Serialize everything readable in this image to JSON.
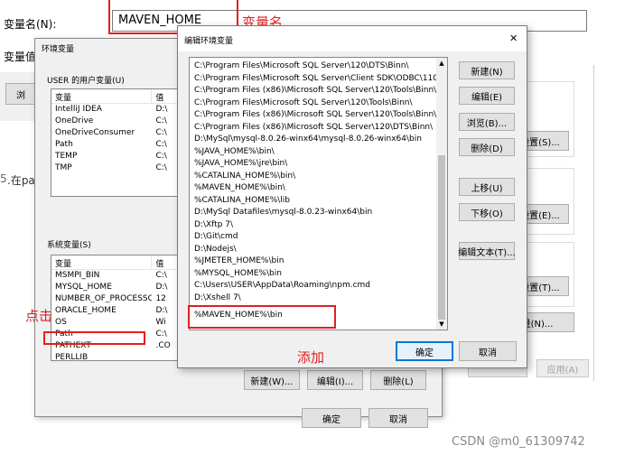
{
  "top_dialog": {
    "var_name_label": "变量名(N):",
    "var_name_value": "MAVEN_HOME",
    "var_value_label": "变量值"
  },
  "bg": {
    "btn_partial": "浏",
    "step_text": ".在pa",
    "step_num": "5"
  },
  "env_dialog": {
    "title": "环境变量",
    "user_section": "USER 的用户变量(U)",
    "col_var": "变量",
    "col_val": "值",
    "user_vars": [
      {
        "name": "IntelliJ IDEA",
        "val": "D:\\"
      },
      {
        "name": "OneDrive",
        "val": "C:\\"
      },
      {
        "name": "OneDriveConsumer",
        "val": "C:\\"
      },
      {
        "name": "Path",
        "val": "C:\\"
      },
      {
        "name": "TEMP",
        "val": "C:\\"
      },
      {
        "name": "TMP",
        "val": "C:\\"
      }
    ],
    "sys_section": "系统变量(S)",
    "sys_vars": [
      {
        "name": "MSMPI_BIN",
        "val": "C:\\"
      },
      {
        "name": "MYSQL_HOME",
        "val": "D:\\"
      },
      {
        "name": "NUMBER_OF_PROCESSORS",
        "val": "12"
      },
      {
        "name": "ORACLE_HOME",
        "val": "D:\\"
      },
      {
        "name": "OS",
        "val": "Wi"
      },
      {
        "name": "Path",
        "val": "C:\\"
      },
      {
        "name": "PATHEXT",
        "val": ".CO"
      },
      {
        "name": "PERLLIB",
        "val": ""
      }
    ],
    "new_btn": "新建(W)...",
    "edit_btn": "编辑(I)...",
    "del_btn": "删除(L)",
    "ok_btn": "确定",
    "cancel_btn": "取消"
  },
  "right_panel": {
    "set1": "设置(S)...",
    "set2": "设置(E)...",
    "set3": "设置(T)...",
    "env_btn": "量(N)...",
    "apply_btn": "应用(A)"
  },
  "edit_dialog": {
    "title": "编辑环境变量",
    "close": "✕",
    "items": [
      "C:\\Program Files\\Microsoft SQL Server\\120\\DTS\\Binn\\",
      "C:\\Program Files\\Microsoft SQL Server\\Client SDK\\ODBC\\110\\T...",
      "C:\\Program Files (x86)\\Microsoft SQL Server\\120\\Tools\\Binn\\",
      "C:\\Program Files\\Microsoft SQL Server\\120\\Tools\\Binn\\",
      "C:\\Program Files (x86)\\Microsoft SQL Server\\120\\Tools\\Binn\\M...",
      "C:\\Program Files (x86)\\Microsoft SQL Server\\120\\DTS\\Binn\\",
      "D:\\MySql\\mysql-8.0.26-winx64\\mysql-8.0.26-winx64\\bin",
      "%JAVA_HOME%\\bin\\",
      "%JAVA_HOME%\\jre\\bin\\",
      "%CATALINA_HOME%\\bin\\",
      "%MAVEN_HOME%\\bin\\",
      "%CATALINA_HOME%\\lib",
      "D:\\MySql Datafiles\\mysql-8.0.23-winx64\\bin",
      "D:\\Xftp 7\\",
      "D:\\Git\\cmd",
      "D:\\Nodejs\\",
      "%JMETER_HOME%\\bin",
      "%MYSQL_HOME%\\bin",
      "C:\\Users\\USER\\AppData\\Roaming\\npm.cmd",
      "D:\\Xshell 7\\",
      "%MAVEN_HOME%\\bin"
    ],
    "buttons": {
      "new": "新建(N)",
      "edit": "编辑(E)",
      "browse": "浏览(B)...",
      "delete": "删除(D)",
      "up": "上移(U)",
      "down": "下移(O)",
      "edit_text": "编辑文本(T)...",
      "ok": "确定",
      "cancel": "取消"
    }
  },
  "annotations": {
    "var_name": "变量名",
    "click": "点击",
    "add": "添加"
  },
  "watermark": "CSDN @m0_61309742"
}
